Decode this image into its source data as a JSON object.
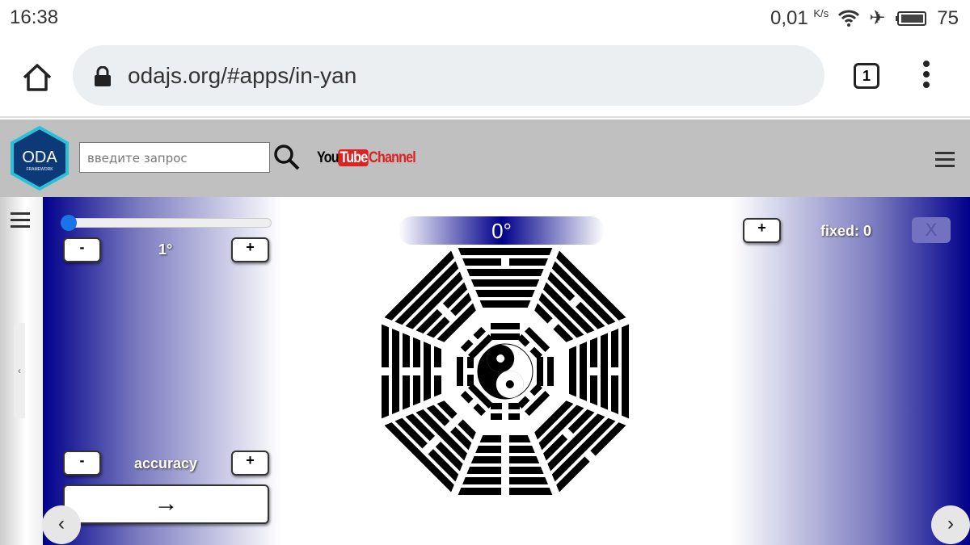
{
  "status_bar": {
    "time": "16:38",
    "net_speed": "0,01",
    "net_unit": "K/s",
    "battery": "75",
    "icons": [
      "wifi-icon",
      "airplane-icon",
      "battery-icon"
    ]
  },
  "browser": {
    "url": "odajs.org/#apps/in-yan",
    "tab_count": "1"
  },
  "header": {
    "logo_text": "ODA",
    "logo_sub": "FRAMEWORK",
    "search_placeholder": "введите запрос",
    "youtube_you": "You",
    "youtube_tube": "Tube",
    "youtube_channel": "Channel"
  },
  "left_panel": {
    "slider_value": 0,
    "step_minus": "-",
    "step_value": "1°",
    "step_plus": "+",
    "acc_minus": "-",
    "accuracy_label": "accuracy",
    "acc_plus": "+",
    "go_label": "→"
  },
  "center": {
    "angle": "0°"
  },
  "right_panel": {
    "plus": "+",
    "fixed_label": "fixed: 0",
    "close": "X"
  },
  "nav": {
    "prev": "‹",
    "next": "›",
    "side_toggle": "‹"
  },
  "colors": {
    "panel_dark": "#00008b",
    "header_bg": "#c0c0c0",
    "slider_thumb": "#1a73e8"
  }
}
